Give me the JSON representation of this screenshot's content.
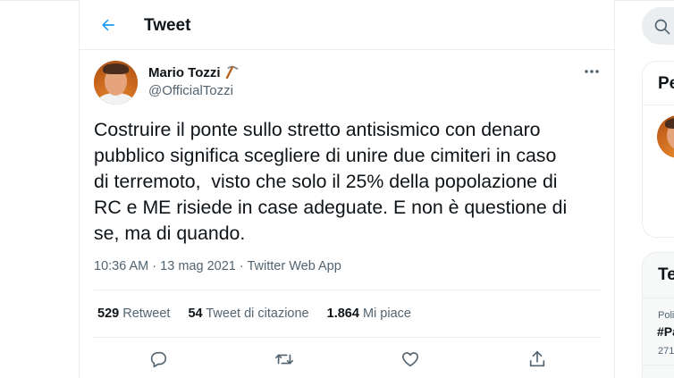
{
  "header": {
    "title": "Tweet"
  },
  "tweet": {
    "author_name": "Mario Tozzi",
    "author_handle": "@OfficialTozzi",
    "text": "Costruire il ponte sullo stretto antisismico con denaro\npubblico significa scegliere di unire due cimiteri in caso\ndi terremoto,  visto che solo il 25% della popolazione di\nRC e ME risiede in case adeguate. E non è questione di\nse, ma di quando.",
    "time": "10:36 AM",
    "date": "13 mag 2021",
    "source": "Twitter Web App",
    "separator": "·"
  },
  "stats": {
    "retweets_count": "529",
    "retweets_label": "Retweet",
    "quotes_count": "54",
    "quotes_label": "Tweet di citazione",
    "likes_count": "1.864",
    "likes_label": "Mi piace"
  },
  "sidebar": {
    "panel1_title": "Pe",
    "panel2_title": "Te",
    "trend_category": "Poli",
    "trend_tag": "#Pa",
    "trend_count": "271"
  },
  "icons": {
    "back": "arrow-left-icon",
    "name_emoji": "pick-icon",
    "more": "more-horizontal-icon",
    "reply": "reply-icon",
    "retweet": "retweet-icon",
    "like": "heart-icon",
    "share": "share-icon",
    "search": "search-icon"
  },
  "colors": {
    "accent": "#1d9bf0",
    "text_primary": "#0f1419",
    "text_secondary": "#536471",
    "border": "#ebeef0"
  }
}
